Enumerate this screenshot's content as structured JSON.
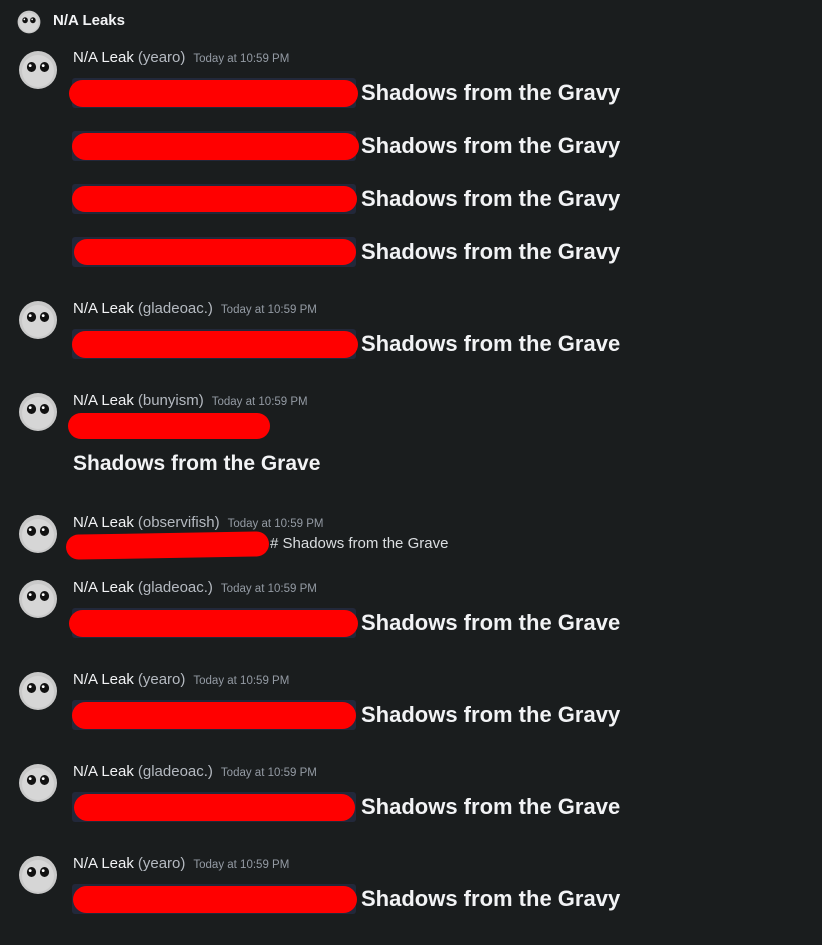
{
  "channel": {
    "title": "N/A Leaks"
  },
  "messages": [
    {
      "author": "N/A Leak",
      "handle": "(yearo)",
      "time": "Today at 10:59 PM",
      "lines": [
        "Shadows from the Gravy",
        "Shadows from the Gravy",
        "Shadows from the Gravy",
        "Shadows from the Gravy"
      ]
    },
    {
      "author": "N/A Leak",
      "handle": "(gladeoac.)",
      "time": "Today at 10:59 PM",
      "lines": [
        "Shadows from the Grave"
      ]
    },
    {
      "author": "N/A Leak",
      "handle": "(bunyism)",
      "time": "Today at 10:59 PM",
      "heading": "Shadows from the Grave"
    },
    {
      "author": "N/A Leak",
      "handle": "(observifish)",
      "time": "Today at 10:59 PM",
      "plain": "# Shadows from the Grave"
    },
    {
      "author": "N/A Leak",
      "handle": "(gladeoac.)",
      "time": "Today at 10:59 PM",
      "lines": [
        "Shadows from the Grave"
      ]
    },
    {
      "author": "N/A Leak",
      "handle": "(yearo)",
      "time": "Today at 10:59 PM",
      "lines": [
        "Shadows from the Gravy"
      ]
    },
    {
      "author": "N/A Leak",
      "handle": "(gladeoac.)",
      "time": "Today at 10:59 PM",
      "lines": [
        "Shadows from the Grave"
      ]
    },
    {
      "author": "N/A Leak",
      "handle": "(yearo)",
      "time": "Today at 10:59 PM",
      "lines": [
        "Shadows from the Gravy"
      ]
    }
  ]
}
